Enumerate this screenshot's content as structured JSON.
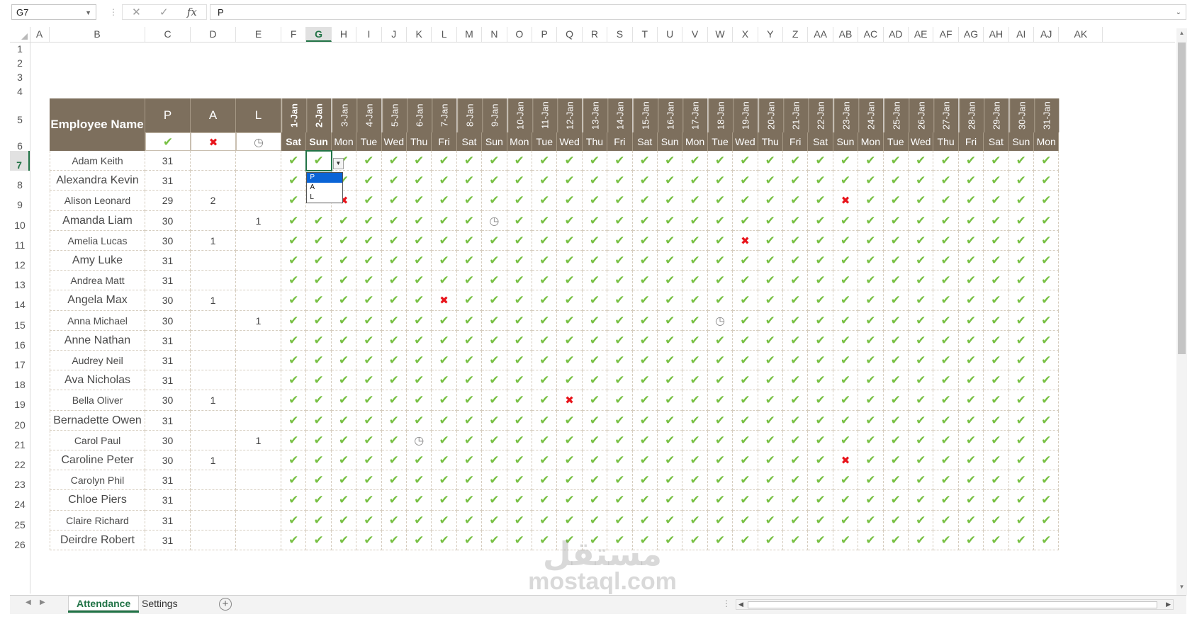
{
  "formula_bar": {
    "name_box": "G7",
    "formula": "P",
    "fx_label": "fx"
  },
  "columns": [
    "A",
    "B",
    "C",
    "D",
    "E",
    "F",
    "G",
    "H",
    "I",
    "J",
    "K",
    "L",
    "M",
    "N",
    "O",
    "P",
    "Q",
    "R",
    "S",
    "T",
    "U",
    "V",
    "W",
    "X",
    "Y",
    "Z",
    "AA",
    "AB",
    "AC",
    "AD",
    "AE",
    "AF",
    "AG",
    "AH",
    "AI",
    "AJ",
    "AK"
  ],
  "row_numbers": [
    "1",
    "2",
    "3",
    "4",
    "5",
    "6",
    "7",
    "8",
    "9",
    "10",
    "11",
    "12",
    "13",
    "14",
    "15",
    "16",
    "17",
    "18",
    "19",
    "20",
    "21",
    "22",
    "23",
    "24",
    "25",
    "26"
  ],
  "table": {
    "name_header": "Employee Name",
    "summary_headers": [
      "P",
      "A",
      "L"
    ],
    "summary_icons": [
      "check-icon",
      "cross-icon",
      "clock-icon"
    ],
    "dates": [
      "1-Jan",
      "2-Jan",
      "3-Jan",
      "4-Jan",
      "5-Jan",
      "6-Jan",
      "7-Jan",
      "8-Jan",
      "9-Jan",
      "10-Jan",
      "11-Jan",
      "12-Jan",
      "13-Jan",
      "14-Jan",
      "15-Jan",
      "16-Jan",
      "17-Jan",
      "18-Jan",
      "19-Jan",
      "20-Jan",
      "21-Jan",
      "22-Jan",
      "23-Jan",
      "24-Jan",
      "25-Jan",
      "26-Jan",
      "27-Jan",
      "28-Jan",
      "29-Jan",
      "30-Jan",
      "31-Jan"
    ],
    "days": [
      "Sat",
      "Sun",
      "Mon",
      "Tue",
      "Wed",
      "Thu",
      "Fri",
      "Sat",
      "Sun",
      "Mon",
      "Tue",
      "Wed",
      "Thu",
      "Fri",
      "Sat",
      "Sun",
      "Mon",
      "Tue",
      "Wed",
      "Thu",
      "Fri",
      "Sat",
      "Sun",
      "Mon",
      "Tue",
      "Wed",
      "Thu",
      "Fri",
      "Sat",
      "Sun",
      "Mon"
    ],
    "employees": [
      {
        "name": "Adam Keith",
        "p": "31",
        "a": "",
        "l": "",
        "exceptions": {}
      },
      {
        "name": "Alexandra Kevin",
        "p": "31",
        "a": "",
        "l": "",
        "exceptions": {}
      },
      {
        "name": "Alison Leonard",
        "p": "29",
        "a": "2",
        "l": "",
        "exceptions": {
          "2": "A",
          "22": "A"
        }
      },
      {
        "name": "Amanda Liam",
        "p": "30",
        "a": "",
        "l": "1",
        "exceptions": {
          "8": "L"
        }
      },
      {
        "name": "Amelia Lucas",
        "p": "30",
        "a": "1",
        "l": "",
        "exceptions": {
          "18": "A"
        }
      },
      {
        "name": "Amy Luke",
        "p": "31",
        "a": "",
        "l": "",
        "exceptions": {}
      },
      {
        "name": "Andrea Matt",
        "p": "31",
        "a": "",
        "l": "",
        "exceptions": {}
      },
      {
        "name": "Angela Max",
        "p": "30",
        "a": "1",
        "l": "",
        "exceptions": {
          "6": "A"
        }
      },
      {
        "name": "Anna Michael",
        "p": "30",
        "a": "",
        "l": "1",
        "exceptions": {
          "17": "L"
        }
      },
      {
        "name": "Anne Nathan",
        "p": "31",
        "a": "",
        "l": "",
        "exceptions": {}
      },
      {
        "name": "Audrey Neil",
        "p": "31",
        "a": "",
        "l": "",
        "exceptions": {}
      },
      {
        "name": "Ava Nicholas",
        "p": "31",
        "a": "",
        "l": "",
        "exceptions": {}
      },
      {
        "name": "Bella Oliver",
        "p": "30",
        "a": "1",
        "l": "",
        "exceptions": {
          "11": "A"
        }
      },
      {
        "name": "Bernadette Owen",
        "p": "31",
        "a": "",
        "l": "",
        "exceptions": {}
      },
      {
        "name": "Carol Paul",
        "p": "30",
        "a": "",
        "l": "1",
        "exceptions": {
          "5": "L"
        }
      },
      {
        "name": "Caroline Peter",
        "p": "30",
        "a": "1",
        "l": "",
        "exceptions": {
          "22": "A"
        }
      },
      {
        "name": "Carolyn Phil",
        "p": "31",
        "a": "",
        "l": "",
        "exceptions": {}
      },
      {
        "name": "Chloe Piers",
        "p": "31",
        "a": "",
        "l": "",
        "exceptions": {}
      },
      {
        "name": "Claire Richard",
        "p": "31",
        "a": "",
        "l": "",
        "exceptions": {}
      },
      {
        "name": "Deirdre Robert",
        "p": "31",
        "a": "",
        "l": "",
        "exceptions": {}
      }
    ]
  },
  "dropdown": {
    "options": [
      "P",
      "A",
      "L"
    ],
    "selected": "P"
  },
  "sheet_tabs": [
    "Attendance",
    "Settings"
  ],
  "active_tab": "Attendance",
  "watermark": {
    "line1": "مستقل",
    "line2": "mostaql.com"
  },
  "colors": {
    "header_bg": "#7d6f5d",
    "present": "#77c043",
    "absent": "#e8141b",
    "leave": "#888888",
    "excel_green": "#217346"
  }
}
